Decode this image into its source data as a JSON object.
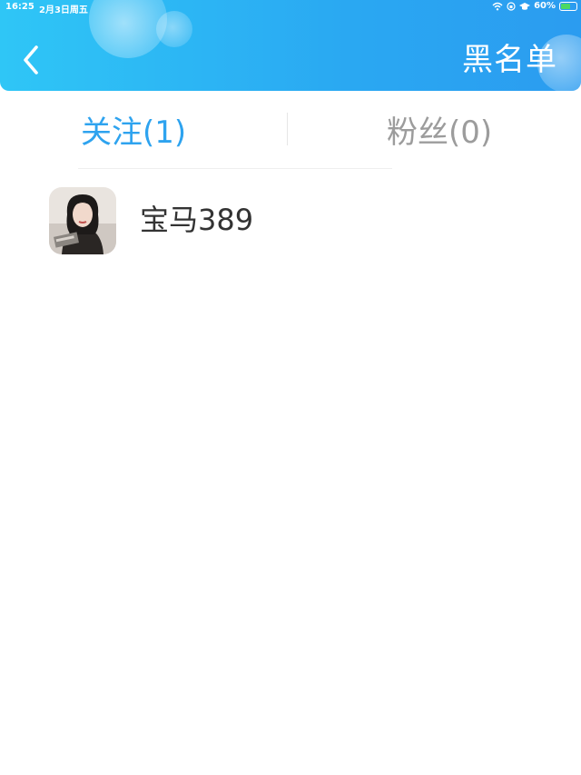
{
  "status_bar": {
    "time": "16:25",
    "date": "2月3日周五",
    "battery": "60%",
    "battery_level": 0.6
  },
  "header": {
    "title": "黑名单",
    "back_icon": "chevron-left-icon"
  },
  "tabs": [
    {
      "label": "关注",
      "count": "(1)",
      "active": true
    },
    {
      "label": "粉丝",
      "count": "(0)",
      "active": false
    }
  ],
  "list": [
    {
      "name": "宝马389",
      "avatar": "user-avatar"
    }
  ],
  "colors": {
    "header_start": "#2fc6f6",
    "header_end": "#2b9cf0",
    "active_tab": "#2ea3ef",
    "inactive_tab": "#9c9c9c",
    "name_text": "#333333"
  }
}
